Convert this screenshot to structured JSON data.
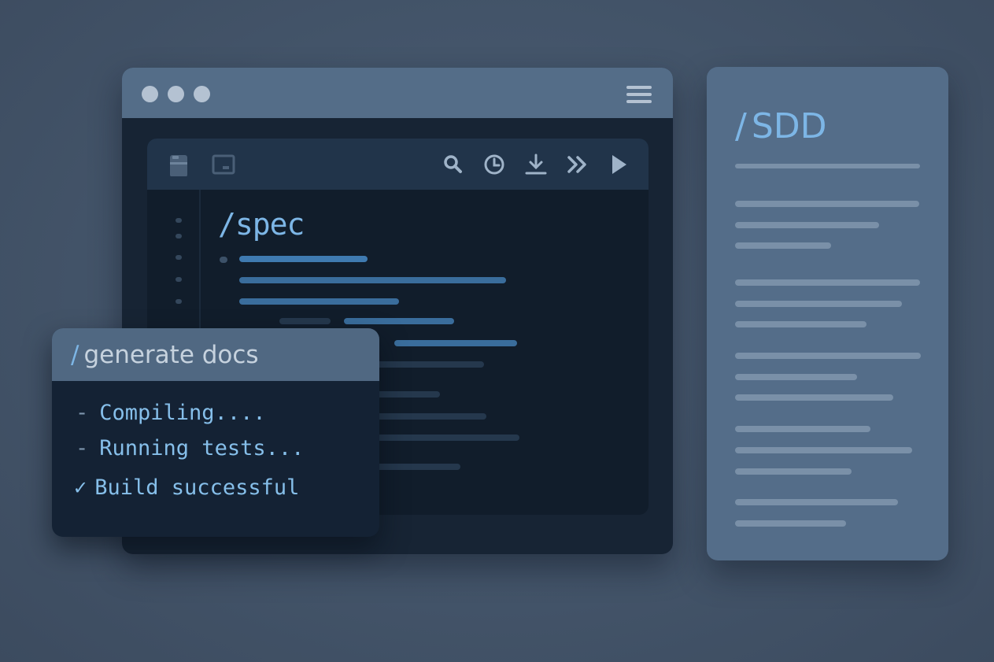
{
  "editor_window": {
    "title_dots": [
      "window-dot-1",
      "window-dot-2",
      "window-dot-3"
    ],
    "menu_icon": "hamburger-menu-icon",
    "toolbar": {
      "left_icons": [
        "file-icon",
        "panel-icon"
      ],
      "right_icons": [
        "search-icon",
        "clock-icon",
        "download-icon",
        "fast-forward-icon",
        "play-icon"
      ]
    },
    "file_title": "/spec"
  },
  "terminal": {
    "title_slash": "/",
    "title": "generate docs",
    "lines": [
      {
        "prefix": "-",
        "text": "Compiling...."
      },
      {
        "prefix": "-",
        "text": "Running tests..."
      },
      {
        "prefix": "✓",
        "text": "Build successful"
      }
    ]
  },
  "document": {
    "title_slash": "/",
    "title": "SDD"
  },
  "colors": {
    "accent": "#7db6e6",
    "background": "#435469",
    "editor_bg": "#111d2b",
    "panel": "#546d89"
  }
}
